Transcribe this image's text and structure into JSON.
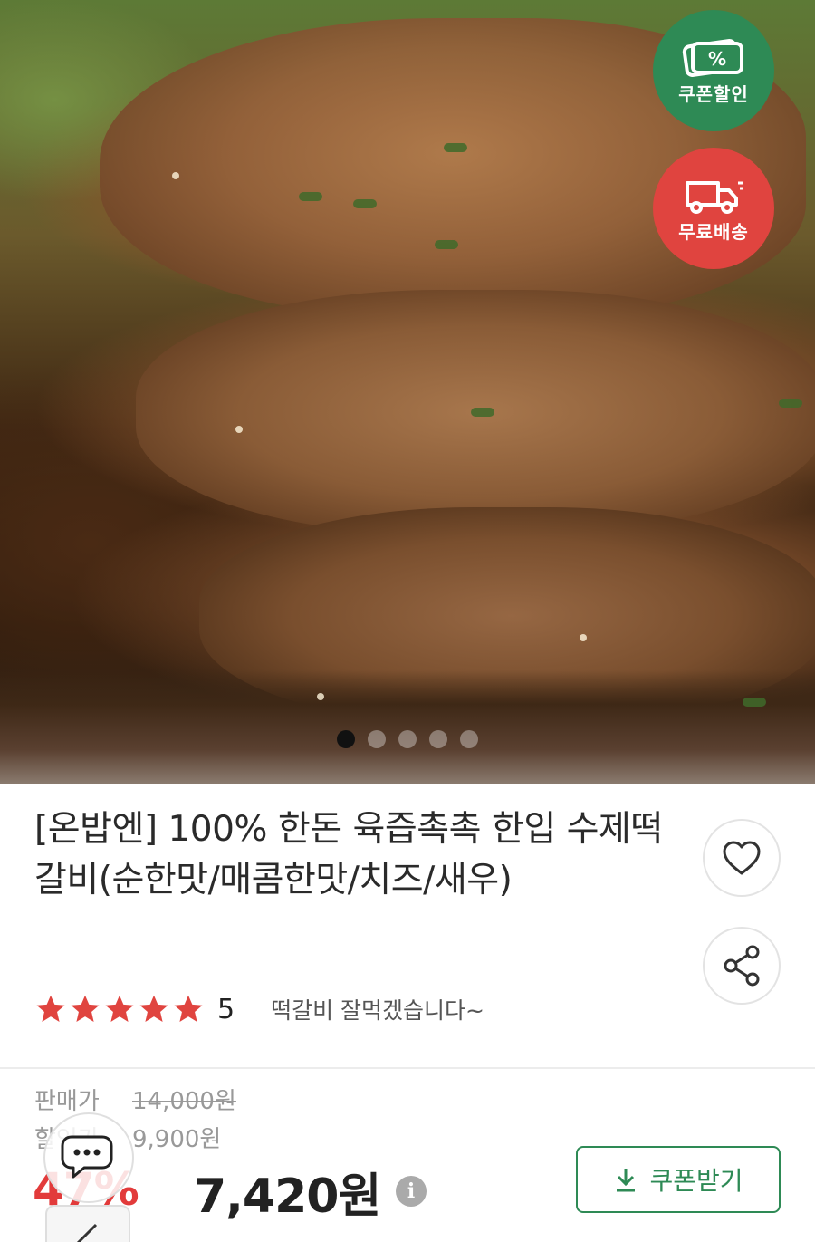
{
  "hero": {
    "badges": {
      "coupon": {
        "label": "쿠폰할인",
        "icon": "coupon-percent-icon",
        "color": "#2e8a55"
      },
      "shipping": {
        "label": "무료배송",
        "icon": "delivery-truck-icon",
        "color": "#e0443f"
      }
    },
    "carousel": {
      "total": 5,
      "active_index": 0
    }
  },
  "product": {
    "title": "[온밥엔] 100% 한돈 육즙촉촉 한입 수제떡갈비(순한맛/매콤한맛/치즈/새우)",
    "rating": "5",
    "rating_stars": 5,
    "review_snippet": "떡갈비 잘먹겠습니다~"
  },
  "price": {
    "sale_label": "판매가",
    "original_price": "14,000원",
    "discount_label": "할인가",
    "discount_price": "9,900원",
    "discount_rate": "47%",
    "final_price": "7,420원"
  },
  "actions": {
    "wish_icon": "heart-icon",
    "share_icon": "share-icon",
    "coupon_button_label": "쿠폰받기",
    "coupon_button_icon": "download-icon"
  },
  "colors": {
    "accent_green": "#2e8a55",
    "accent_red": "#e23b3b",
    "star": "#e0443f"
  }
}
